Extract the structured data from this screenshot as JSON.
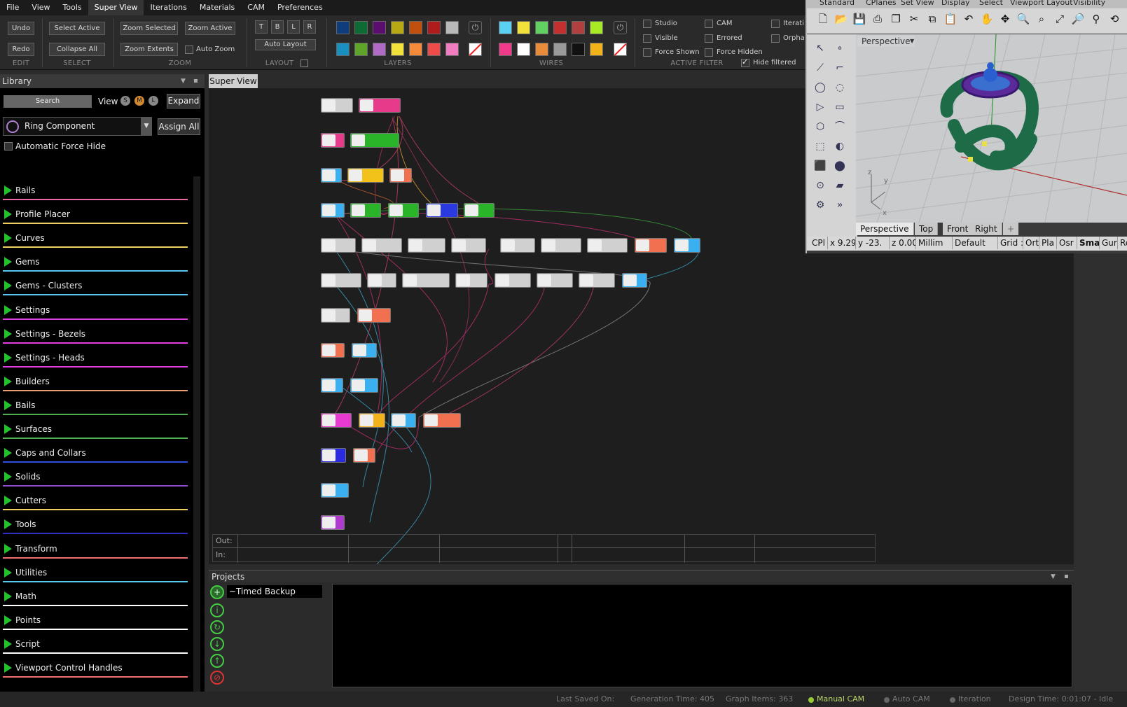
{
  "menu": [
    "File",
    "View",
    "Tools",
    "Super View",
    "Iterations",
    "Materials",
    "CAM",
    "Preferences"
  ],
  "ribbon": {
    "edit": {
      "undo": "Undo",
      "redo": "Redo",
      "label": "EDIT"
    },
    "select": {
      "select_active": "Select Active",
      "collapse_all": "Collapse All",
      "label": "SELECT"
    },
    "zoom": {
      "zoom_selected": "Zoom Selected",
      "zoom_active": "Zoom Active",
      "zoom_extents": "Zoom Extents",
      "auto_zoom": "Auto Zoom",
      "label": "ZOOM"
    },
    "layout": {
      "t": "T",
      "b": "B",
      "l": "L",
      "r": "R",
      "auto_layout": "Auto Layout",
      "label": "LAYOUT"
    },
    "layers": {
      "label": "LAYERS",
      "row1": [
        "#0f3c7a",
        "#0e6b33",
        "#5a0f6e",
        "#b7a814",
        "#c1500e",
        "#b01c1c",
        "#b9b9b9"
      ],
      "row2": [
        "#1a8fc2",
        "#5ea52a",
        "#b06cc4",
        "#f2e13a",
        "#f58a3a",
        "#ee4b4b",
        "#f27cc0"
      ]
    },
    "wires": {
      "label": "WIRES",
      "row1": [
        "#5ad1f2",
        "#f2e13a",
        "#60d060",
        "#c43030",
        "#b04040",
        "#a8ea26"
      ],
      "row2": [
        "#f23a8a",
        "#ffffff",
        "#e88b3a",
        "#9a9a9a",
        "#111111",
        "#f2b21a"
      ]
    },
    "filter": {
      "label": "ACTIVE FILTER",
      "studio": "Studio",
      "visible": "Visible",
      "force_shown": "Force Shown",
      "cam": "CAM",
      "errored": "Errored",
      "force_hidden": "Force Hidden",
      "iterati": "Iterati",
      "orpha": "Orpha",
      "hide_filtered": "Hide filtered"
    }
  },
  "library": {
    "title": "Library",
    "search": "Search",
    "view": "View",
    "view_s": "S",
    "view_m": "M",
    "view_l": "L",
    "expand": "Expand",
    "component": "Ring Component",
    "assign_all": "Assign All",
    "auto_force_hide": "Automatic Force Hide",
    "categories": [
      {
        "name": "Rails",
        "color": "#e86aa0"
      },
      {
        "name": "Profile Placer",
        "color": "#f0d060"
      },
      {
        "name": "Curves",
        "color": "#f0d060"
      },
      {
        "name": "Gems",
        "color": "#5ac8f0"
      },
      {
        "name": "Gems - Clusters",
        "color": "#5ac8f0"
      },
      {
        "name": "Settings",
        "color": "#e040e0"
      },
      {
        "name": "Settings - Bezels",
        "color": "#e040e0"
      },
      {
        "name": "Settings - Heads",
        "color": "#e040e0"
      },
      {
        "name": "Builders",
        "color": "#e8a070"
      },
      {
        "name": "Bails",
        "color": "#50b050"
      },
      {
        "name": "Surfaces",
        "color": "#50b050"
      },
      {
        "name": "Caps and Collars",
        "color": "#3050e0"
      },
      {
        "name": "Solids",
        "color": "#9050d0"
      },
      {
        "name": "Cutters",
        "color": "#f0d060"
      },
      {
        "name": "Tools",
        "color": "#3030c0"
      },
      {
        "name": "Transform",
        "color": "#f07070"
      },
      {
        "name": "Utilities",
        "color": "#5ac8f0"
      },
      {
        "name": "Math",
        "color": "#ffffff"
      },
      {
        "name": "Points",
        "color": "#ffffff"
      },
      {
        "name": "Script",
        "color": "#ffffff"
      },
      {
        "name": "Viewport Control Handles",
        "color": "#f07070"
      }
    ]
  },
  "superview": {
    "tab": "Super View",
    "out": "Out:",
    "in": "In:"
  },
  "projects": {
    "title": "Projects",
    "item": "~Timed Backup"
  },
  "status": {
    "last_saved": "Last Saved On:",
    "generation": "Generation Time: 405",
    "graph_items": "Graph Items: 363",
    "manual_cam": "Manual CAM",
    "auto_cam": "Auto CAM",
    "iteration": "Iteration",
    "design_time": "Design Time: 0:01:07 - Idle"
  },
  "rhino": {
    "tabs": [
      "Standard",
      "CPlanes",
      "Set View",
      "Display",
      "Select",
      "Viewport Layout",
      "Visibility"
    ],
    "viewport_name": "Perspective",
    "viewport_tabs": [
      "Perspective",
      "Top",
      "Front",
      "Right"
    ],
    "coords": [
      "CPl",
      "x 9.29",
      "y -23.",
      "z 0.00",
      "Millim",
      "Default",
      "Grid :",
      "Ort",
      "Pla",
      "Osr",
      "Smar",
      "Gur",
      "Rec"
    ]
  }
}
